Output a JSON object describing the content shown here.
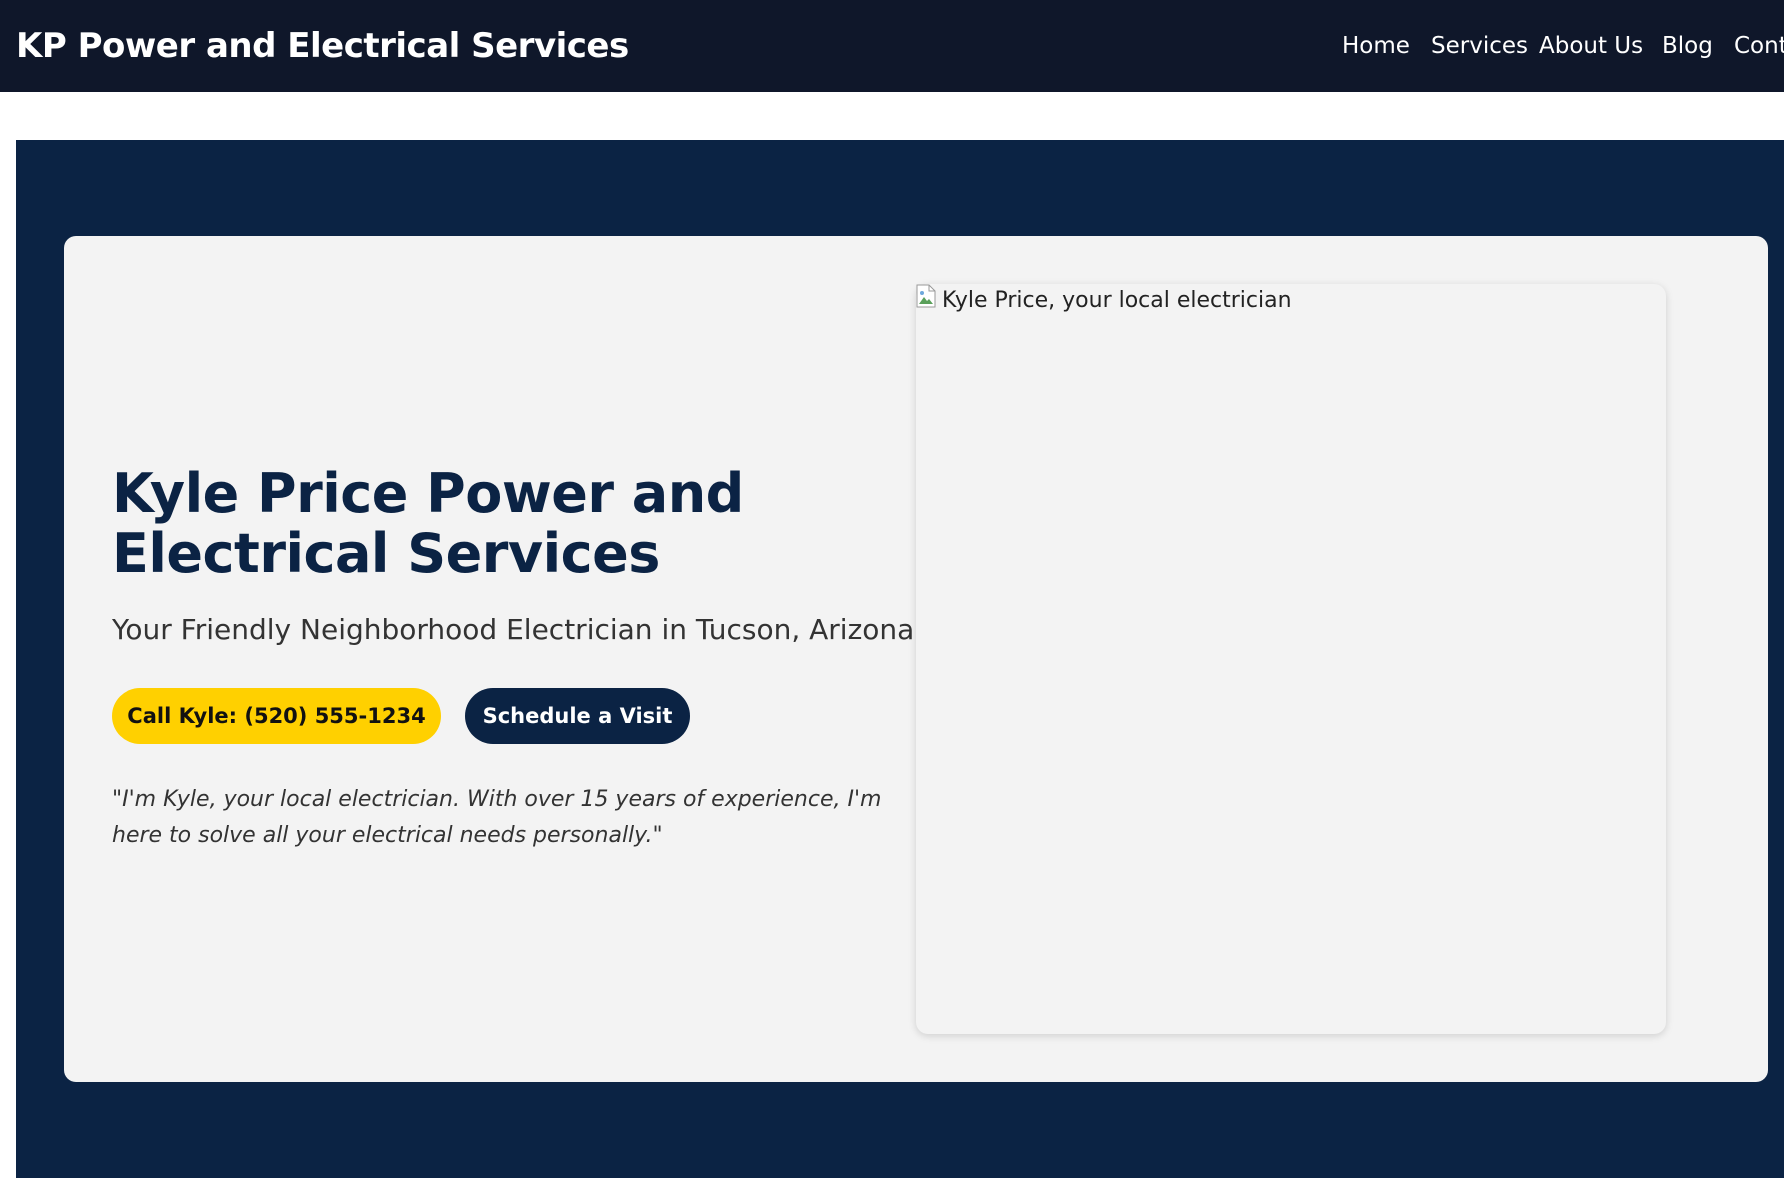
{
  "header": {
    "site_title": "KP Power and Electrical Services",
    "nav": [
      {
        "label": "Home"
      },
      {
        "label": "Services"
      },
      {
        "label": "About Us"
      },
      {
        "label": "Blog"
      },
      {
        "label": "Cont"
      }
    ]
  },
  "hero": {
    "heading": "Kyle Price Power and Electrical Services",
    "subtitle": "Your Friendly Neighborhood Electrician in Tucson, Arizona",
    "call_button": "Call Kyle: (520) 555-1234",
    "schedule_button": "Schedule a Visit",
    "quote": "\"I'm Kyle, your local electrician. With over 15 years of experience, I'm here to solve all your electrical needs personally.\"",
    "photo_alt": "Kyle Price, your local electrician",
    "photo_icon": "broken-image-icon"
  },
  "colors": {
    "header_bg": "#0f172a",
    "hero_bg": "#0b2344",
    "card_bg": "#f3f3f3",
    "accent_yellow": "#ffd000",
    "heading_navy": "#0b2344"
  }
}
